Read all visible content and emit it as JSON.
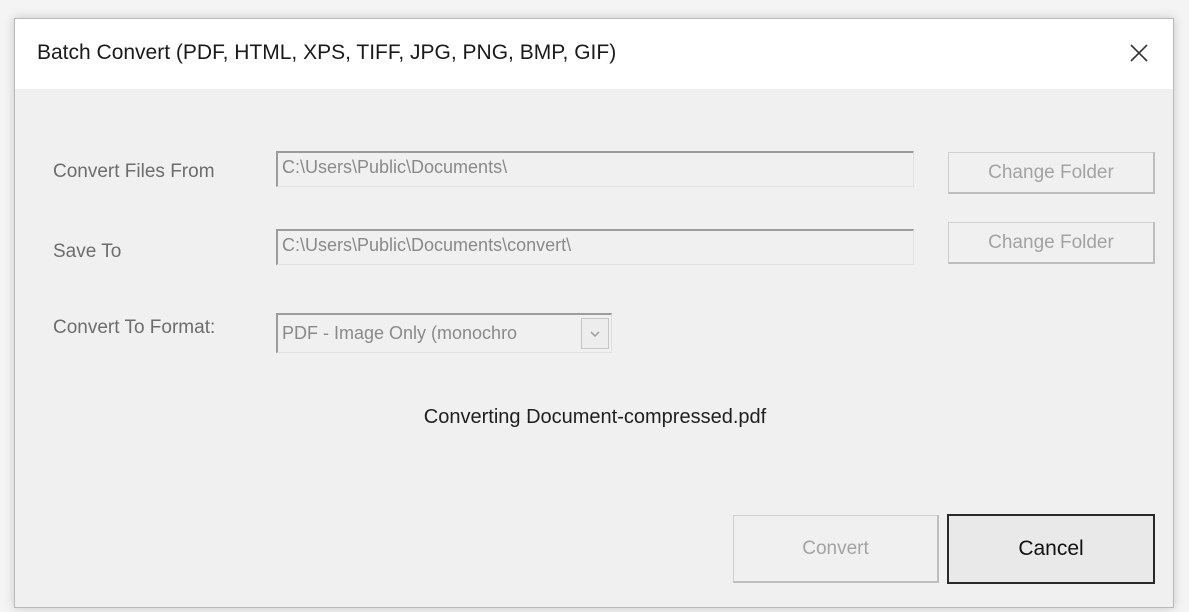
{
  "dialog": {
    "title": "Batch Convert (PDF, HTML, XPS, TIFF, JPG, PNG, BMP, GIF)",
    "close_glyph": "✕"
  },
  "form": {
    "convert_from_label": "Convert Files From",
    "convert_from_value": "C:\\Users\\Public\\Documents\\",
    "save_to_label": "Save To",
    "save_to_value": "C:\\Users\\Public\\Documents\\convert\\",
    "format_label": "Convert To Format:",
    "format_value": "PDF - Image Only (monochro",
    "change_folder_label": "Change Folder"
  },
  "status": {
    "text": "Converting Document-compressed.pdf"
  },
  "actions": {
    "convert_label": "Convert",
    "cancel_label": "Cancel"
  }
}
